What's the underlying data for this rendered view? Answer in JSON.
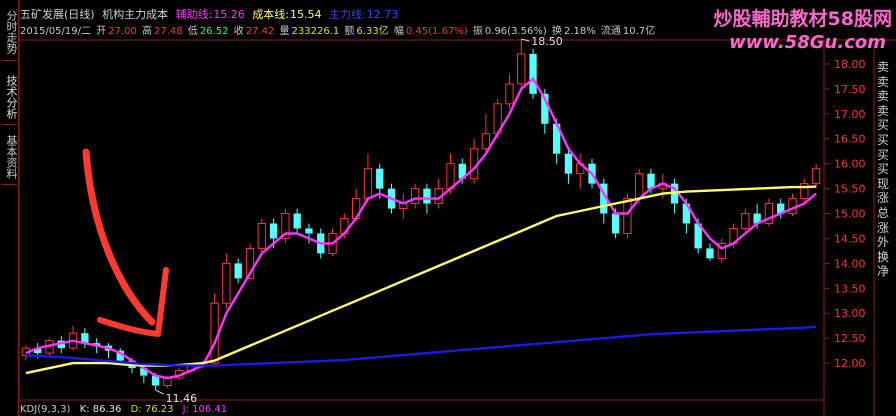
{
  "side_tabs": [
    "分时走势",
    "技术分析",
    "基本资料"
  ],
  "header": {
    "stock": "五矿发展(日线)",
    "indicator": "机构主力成本",
    "line1_label": "辅助线:",
    "line1_value": "15.26",
    "line2_label": "成本线:",
    "line2_value": "15.54",
    "line3_label": "主力线:",
    "line3_value": "12.73"
  },
  "quote": {
    "date": "2015/05/19/二",
    "open_label": "开",
    "open": "27.00",
    "high_label": "高",
    "high": "27.48",
    "low_label": "低",
    "low": "26.52",
    "close_label": "收",
    "close": "27.42",
    "volume_label": "量",
    "volume": "233226.1",
    "amount_label": "额",
    "amount": "6.33亿",
    "change_label": "幅",
    "change": "0.45(1.67%)",
    "amplitude_label": "振",
    "amplitude": "0.96(3.56%)",
    "turnover_label": "换",
    "turnover": "2.18%",
    "float_label": "流通",
    "float": "10.7亿"
  },
  "watermark": {
    "line1": "炒股輔助教材58股网",
    "line2": "www.58Gu.com"
  },
  "price_axis": [
    "18.00",
    "17.50",
    "17.00",
    "16.50",
    "16.00",
    "15.50",
    "15.00",
    "14.50",
    "14.00",
    "13.50",
    "13.00",
    "12.50",
    "12.00"
  ],
  "markers": {
    "high": "18.50",
    "low": "11.46"
  },
  "right_labels": [
    "卖",
    "卖",
    "卖",
    "卖",
    "买",
    "买",
    "买",
    "买",
    "现",
    "涨",
    "总",
    "涨",
    "外",
    "换",
    "净"
  ],
  "kdj": {
    "label": "KDJ(9,3,3)",
    "k": "K: 86.36",
    "d": "D: 76.23",
    "j": "J: 106.41"
  },
  "colors": {
    "up": "#ff3333",
    "down": "#54ffff",
    "line_magenta": "#ff33ff",
    "line_yellow": "#ffff66",
    "line_blue": "#1a1ae6",
    "frame": "#8b1a1a",
    "arrow": "#ff3b2f"
  },
  "chart_data": {
    "type": "candlestick",
    "ylim": [
      11.3,
      18.4
    ],
    "candles": [
      [
        12.15,
        12.3,
        12.05,
        12.35
      ],
      [
        12.3,
        12.2,
        12.1,
        12.4
      ],
      [
        12.2,
        12.45,
        12.15,
        12.5
      ],
      [
        12.45,
        12.3,
        12.2,
        12.55
      ],
      [
        12.3,
        12.6,
        12.25,
        12.75
      ],
      [
        12.6,
        12.4,
        12.3,
        12.7
      ],
      [
        12.4,
        12.35,
        12.2,
        12.5
      ],
      [
        12.35,
        12.25,
        12.1,
        12.4
      ],
      [
        12.25,
        12.05,
        11.95,
        12.3
      ],
      [
        12.05,
        11.9,
        11.8,
        12.1
      ],
      [
        11.9,
        11.75,
        11.6,
        11.95
      ],
      [
        11.75,
        11.55,
        11.46,
        11.8
      ],
      [
        11.55,
        11.7,
        11.5,
        11.75
      ],
      [
        11.7,
        11.85,
        11.65,
        11.9
      ],
      [
        11.85,
        11.95,
        11.8,
        12.0
      ],
      [
        11.95,
        12.0,
        11.9,
        12.05
      ],
      [
        12.0,
        13.2,
        11.95,
        13.4
      ],
      [
        13.2,
        14.0,
        13.1,
        14.2
      ],
      [
        14.0,
        13.7,
        13.6,
        14.1
      ],
      [
        13.7,
        14.3,
        13.65,
        14.4
      ],
      [
        14.3,
        14.8,
        14.2,
        14.9
      ],
      [
        14.8,
        14.5,
        14.3,
        14.9
      ],
      [
        14.5,
        15.0,
        14.4,
        15.1
      ],
      [
        15.0,
        14.7,
        14.6,
        15.1
      ],
      [
        14.7,
        14.6,
        14.4,
        14.8
      ],
      [
        14.6,
        14.2,
        14.1,
        14.7
      ],
      [
        14.2,
        14.6,
        14.15,
        14.7
      ],
      [
        14.6,
        14.9,
        14.5,
        15.0
      ],
      [
        14.9,
        15.3,
        14.85,
        15.5
      ],
      [
        15.3,
        15.9,
        15.2,
        16.2
      ],
      [
        15.9,
        15.5,
        15.3,
        16.0
      ],
      [
        15.5,
        15.1,
        15.0,
        15.6
      ],
      [
        15.1,
        15.2,
        14.9,
        15.4
      ],
      [
        15.2,
        15.5,
        15.1,
        15.6
      ],
      [
        15.5,
        15.2,
        15.0,
        15.6
      ],
      [
        15.2,
        15.5,
        15.1,
        15.7
      ],
      [
        15.5,
        16.0,
        15.4,
        16.2
      ],
      [
        16.0,
        15.7,
        15.6,
        16.1
      ],
      [
        15.7,
        16.3,
        15.6,
        16.5
      ],
      [
        16.3,
        16.6,
        16.2,
        17.0
      ],
      [
        16.6,
        17.2,
        16.5,
        17.3
      ],
      [
        17.2,
        17.6,
        17.1,
        17.8
      ],
      [
        17.6,
        18.2,
        17.5,
        18.5
      ],
      [
        18.2,
        17.4,
        17.3,
        18.3
      ],
      [
        17.4,
        16.8,
        16.6,
        17.5
      ],
      [
        16.8,
        16.2,
        16.0,
        16.9
      ],
      [
        16.2,
        15.8,
        15.6,
        16.3
      ],
      [
        15.8,
        16.0,
        15.5,
        16.2
      ],
      [
        16.0,
        15.6,
        15.5,
        16.1
      ],
      [
        15.6,
        15.0,
        14.8,
        15.7
      ],
      [
        15.0,
        14.6,
        14.5,
        15.1
      ],
      [
        14.6,
        15.3,
        14.5,
        15.4
      ],
      [
        15.3,
        15.8,
        15.2,
        15.9
      ],
      [
        15.8,
        15.5,
        15.4,
        15.9
      ],
      [
        15.5,
        15.6,
        15.3,
        15.8
      ],
      [
        15.6,
        15.2,
        15.0,
        15.7
      ],
      [
        15.2,
        14.8,
        14.6,
        15.3
      ],
      [
        14.8,
        14.3,
        14.2,
        14.9
      ],
      [
        14.3,
        14.1,
        14.05,
        14.4
      ],
      [
        14.1,
        14.4,
        14.0,
        14.5
      ],
      [
        14.4,
        14.7,
        14.3,
        14.8
      ],
      [
        14.7,
        15.0,
        14.6,
        15.1
      ],
      [
        15.0,
        14.8,
        14.7,
        15.2
      ],
      [
        14.8,
        15.2,
        14.75,
        15.3
      ],
      [
        15.2,
        15.0,
        14.9,
        15.3
      ],
      [
        15.0,
        15.3,
        14.95,
        15.4
      ],
      [
        15.3,
        15.6,
        15.2,
        15.7
      ],
      [
        15.6,
        15.9,
        15.5,
        16.0
      ]
    ],
    "series": [
      {
        "name": "辅助线",
        "color": "#ff33ff",
        "values": [
          12.2,
          12.3,
          12.35,
          12.4,
          12.45,
          12.4,
          12.35,
          12.3,
          12.2,
          12.05,
          11.9,
          11.75,
          11.7,
          11.75,
          11.85,
          11.95,
          12.4,
          13.0,
          13.4,
          13.8,
          14.2,
          14.4,
          14.6,
          14.6,
          14.5,
          14.4,
          14.4,
          14.6,
          14.9,
          15.3,
          15.4,
          15.3,
          15.2,
          15.3,
          15.3,
          15.3,
          15.5,
          15.7,
          15.9,
          16.2,
          16.6,
          17.0,
          17.5,
          17.7,
          17.3,
          16.8,
          16.3,
          16.0,
          15.8,
          15.4,
          15.0,
          15.0,
          15.3,
          15.5,
          15.6,
          15.5,
          15.2,
          14.8,
          14.5,
          14.3,
          14.4,
          14.6,
          14.8,
          14.9,
          15.0,
          15.1,
          15.2,
          15.4
        ]
      },
      {
        "name": "成本线",
        "color": "#ffff66",
        "values": [
          11.8,
          11.85,
          11.9,
          11.95,
          12.0,
          12.0,
          12.0,
          12.0,
          11.98,
          11.96,
          11.95,
          11.95,
          11.95,
          11.96,
          11.98,
          12.0,
          12.05,
          12.15,
          12.25,
          12.35,
          12.45,
          12.55,
          12.65,
          12.75,
          12.85,
          12.95,
          13.05,
          13.15,
          13.25,
          13.35,
          13.45,
          13.55,
          13.65,
          13.75,
          13.85,
          13.95,
          14.05,
          14.15,
          14.25,
          14.35,
          14.45,
          14.55,
          14.65,
          14.75,
          14.85,
          14.95,
          15.0,
          15.05,
          15.1,
          15.15,
          15.2,
          15.25,
          15.3,
          15.35,
          15.4,
          15.42,
          15.44,
          15.45,
          15.46,
          15.47,
          15.48,
          15.49,
          15.5,
          15.51,
          15.52,
          15.53,
          15.53,
          15.54
        ]
      },
      {
        "name": "主力线",
        "color": "#1a1ae6",
        "values": [
          12.15,
          12.14,
          12.13,
          12.12,
          12.1,
          12.08,
          12.06,
          12.04,
          12.02,
          12.0,
          11.98,
          11.97,
          11.96,
          11.95,
          11.95,
          11.95,
          11.95,
          11.96,
          11.97,
          11.98,
          11.99,
          12.0,
          12.01,
          12.02,
          12.03,
          12.04,
          12.05,
          12.06,
          12.08,
          12.1,
          12.12,
          12.14,
          12.16,
          12.18,
          12.2,
          12.22,
          12.24,
          12.26,
          12.28,
          12.3,
          12.32,
          12.34,
          12.36,
          12.38,
          12.4,
          12.42,
          12.44,
          12.46,
          12.48,
          12.5,
          12.52,
          12.54,
          12.56,
          12.58,
          12.59,
          12.6,
          12.61,
          12.62,
          12.63,
          12.64,
          12.65,
          12.66,
          12.67,
          12.68,
          12.69,
          12.7,
          12.71,
          12.73
        ]
      }
    ]
  }
}
